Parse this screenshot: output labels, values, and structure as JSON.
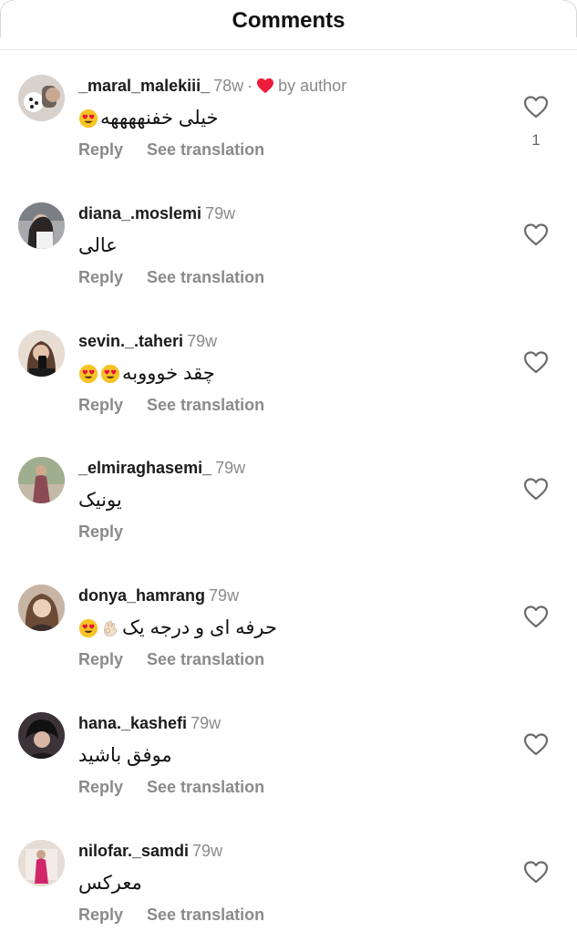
{
  "header": {
    "title": "Comments"
  },
  "comments": [
    {
      "username": "_maral_malekiii_",
      "time": "78w",
      "by_author": "by author",
      "text": "خیلی خفنههههه",
      "emoji_after": 1,
      "like_count": "1",
      "actions": {
        "reply": "Reply",
        "translate": "See translation"
      }
    },
    {
      "username": "diana_.moslemi",
      "time": "79w",
      "text": "عالی",
      "actions": {
        "reply": "Reply",
        "translate": "See translation"
      }
    },
    {
      "username": "sevin._.taheri",
      "time": "79w",
      "text": "چقد خوووبه",
      "emoji_after": 2,
      "actions": {
        "reply": "Reply",
        "translate": "See translation"
      }
    },
    {
      "username": "_elmiraghasemi_",
      "time": "79w",
      "text": "یونیک",
      "actions": {
        "reply": "Reply"
      }
    },
    {
      "username": "donya_hamrang",
      "time": "79w",
      "text": "حرفه ای و درجه یک",
      "actions": {
        "reply": "Reply",
        "translate": "See translation"
      }
    },
    {
      "username": "hana._kashefi",
      "time": "79w",
      "text": "موفق باشید",
      "actions": {
        "reply": "Reply",
        "translate": "See translation"
      }
    },
    {
      "username": "nilofar._samdi",
      "time": "79w",
      "text": "معرکس",
      "actions": {
        "reply": "Reply",
        "translate": "See translation"
      }
    }
  ],
  "icons": {
    "like": "heart-outline-icon",
    "author_like": "heart-filled-icon",
    "emoji": "heart-eyes-emoji",
    "ok": "ok-hand-emoji"
  },
  "colors": {
    "author_heart": "#ed1c3a",
    "muted": "#8a8a8a",
    "emoji": "#f7c325"
  }
}
